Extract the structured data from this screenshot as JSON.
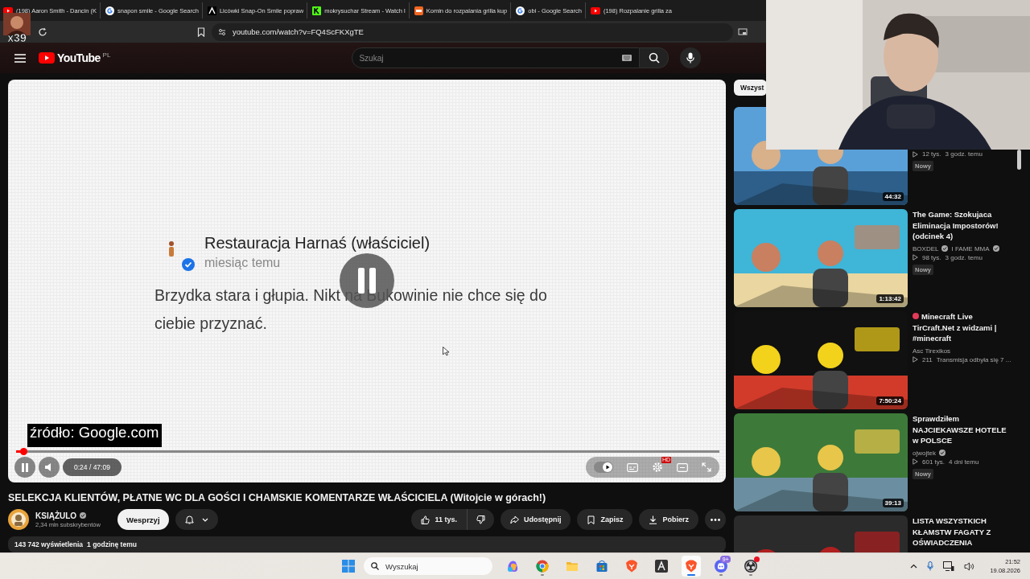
{
  "browser": {
    "tabs": [
      {
        "kind": "youtube",
        "title": "(198) Aaron Smith - Dancin (K"
      },
      {
        "kind": "google",
        "title": "snapon smile - Google Search"
      },
      {
        "kind": "letter-a",
        "title": "Licówki Snap-On Smile popraw"
      },
      {
        "kind": "kick",
        "title": "mokrysuchar Stream - Watch l"
      },
      {
        "kind": "orange",
        "title": "Komin do rozpalania grilla kup"
      },
      {
        "kind": "google",
        "title": "obi - Google Search"
      },
      {
        "kind": "youtube",
        "title": "(198) Rozpalanie grilla za"
      }
    ],
    "url": "youtube.com/watch?v=FQ4ScFKXgTE"
  },
  "stream_overlay": {
    "badge": "x39"
  },
  "header": {
    "logo": "YouTube",
    "region": "PL",
    "search_placeholder": "Szukaj"
  },
  "player": {
    "comment": {
      "author": "Restauracja Harnaś (właściciel)",
      "time": "miesiąc temu",
      "text": "Brzydka stara i głupia. Nikt na Bukowinie nie chce się do ciebie przyznać."
    },
    "progress": {
      "level": 0.012
    },
    "time": "0:24 / 47:09",
    "source_caption": "źródło: Google.com",
    "autoplay": {
      "on": true
    },
    "quality_badge": "HD"
  },
  "video": {
    "title": "SELEKCJA KLIENTÓW, PŁATNE WC DLA GOŚCI I CHAMSKIE KOMENTARZE WŁAŚCICIELA (Witojcie w górach!)",
    "channel": "KSIĄŻULO",
    "verified": true,
    "subscribers": "2,34 mln subskrybentów",
    "support_button": "Wesprzyj",
    "likes": "11 tys.",
    "share": "Udostępnij",
    "save": "Zapisz",
    "download": "Pobierz",
    "views": "143 742 wyświetlenia",
    "published": "1 godzinę temu"
  },
  "sidebar": {
    "chips": [
      {
        "label": "Wszyst",
        "selected": true
      }
    ],
    "items": [
      {
        "duration": "44:32",
        "views": "12 tys.",
        "age": "3 godz. temu",
        "badge": "Nowy"
      },
      {
        "title": "The Game: Szokujaca Eliminacja Impostorów! (odcinek 4)",
        "channel": "BOXDEL",
        "verified": true,
        "channel_2": "I FAME MMA",
        "verified_2": true,
        "views": "98 tys.",
        "age": "3 godz. temu",
        "badge": "Nowy",
        "duration": "1:13:42"
      },
      {
        "title": "Minecraft Live TirCraft.Net z widzami | #minecraft",
        "live": true,
        "channel": "Asc Tirexikos",
        "views": "211",
        "age": "Transmisja odbyła się 7 ...",
        "duration": "7:50:24"
      },
      {
        "title": "Sprawdziłem NAJCIEKAWSZE HOTELE w POLSCE",
        "channel": "ojwojtek",
        "verified": true,
        "views": "601 tys.",
        "age": "4 dni temu",
        "badge": "Nowy",
        "duration": "39:13"
      },
      {
        "title": "LISTA WSZYSTKICH KŁAMSTW FAGATY Z OŚWIADCZENIA"
      }
    ]
  },
  "taskbar": {
    "search_placeholder": "Wyszukaj",
    "apps": [
      {
        "kind": "copilot",
        "running": false,
        "selected": false
      },
      {
        "kind": "chrome",
        "running": true,
        "selected": false
      },
      {
        "kind": "folder",
        "running": false,
        "selected": false
      },
      {
        "kind": "store",
        "running": false,
        "selected": false
      },
      {
        "kind": "brave",
        "running": false,
        "selected": false
      },
      {
        "kind": "a-app",
        "running": false,
        "selected": false
      },
      {
        "kind": "brave",
        "running": true,
        "selected": true
      },
      {
        "kind": "discord",
        "running": true,
        "selected": false,
        "badge": "9+"
      },
      {
        "kind": "obs",
        "running": true,
        "selected": false,
        "alert": true
      }
    ],
    "time": "21:52",
    "date": "19.08.2026"
  }
}
